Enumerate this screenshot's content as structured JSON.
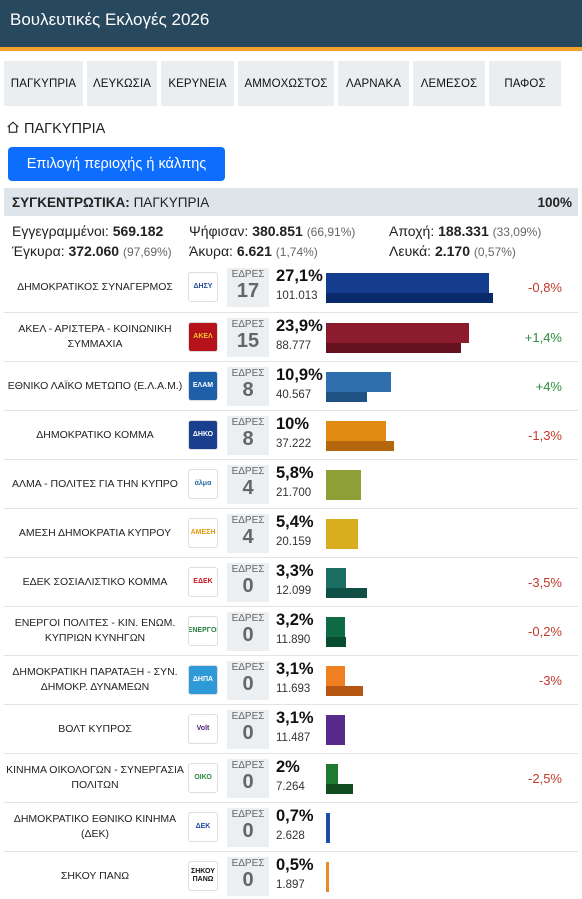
{
  "app": {
    "title": "Βουλευτικές Εκλογές 2026"
  },
  "tabs": [
    "ΠΑΓΚΥΠΡΙΑ",
    "ΛΕΥΚΩΣΙΑ",
    "ΚΕΡΥΝΕΙΑ",
    "ΑΜΜΟΧΩΣΤΟΣ",
    "ΛΑΡΝΑΚΑ",
    "ΛΕΜΕΣΟΣ",
    "ΠΑΦΟΣ"
  ],
  "breadcrumb": {
    "label": "ΠΑΓΚΥΠΡΙΑ",
    "icon": "home-icon"
  },
  "select_button": {
    "label": "Επιλογή περιοχής ή κάλπης"
  },
  "summary": {
    "prefix": "ΣΥΓΚΕΝΤΡΩΤΙΚΑ:",
    "region": "ΠΑΓΚΥΠΡΙΑ",
    "counted": "100%"
  },
  "stats": {
    "registered_label": "Εγγεγραμμένοι:",
    "registered": "569.182",
    "voted_label": "Ψήφισαν:",
    "voted": "380.851",
    "voted_pct": "(66,91%)",
    "abstention_label": "Αποχή:",
    "abstention": "188.331",
    "abstention_pct": "(33,09%)",
    "valid_label": "Έγκυρα:",
    "valid": "372.060",
    "valid_pct": "(97,69%)",
    "invalid_label": "Άκυρα:",
    "invalid": "6.621",
    "invalid_pct": "(1,74%)",
    "blank_label": "Λευκά:",
    "blank": "2.170",
    "blank_pct": "(0,57%)"
  },
  "seats_label": "ΕΔΡΕΣ",
  "parties": [
    {
      "name": "ΔΗΜΟΚΡΑΤΙΚΟΣ ΣΥΝΑΓΕΡΜΟΣ",
      "seats": "17",
      "pct": "27,1%",
      "votes": "101.013",
      "change": "-0,8%",
      "change_type": "neg",
      "share": 27.1,
      "prev_share": 27.9,
      "color": "#143d8f",
      "color_dark": "#0b2a6b",
      "logo_bg": "#ffffff",
      "logo_fg": "#1f4e9a",
      "logo_text": "ΔΗΣΥ",
      "logo_icon": "eagle-icon"
    },
    {
      "name": "ΑΚΕΛ - ΑΡΙΣΤΕΡΑ - ΚΟΙΝΩΝΙΚΗ ΣΥΜΜΑΧΙΑ",
      "seats": "15",
      "pct": "23,9%",
      "votes": "88.777",
      "change": "+1,4%",
      "change_type": "pos",
      "share": 23.9,
      "prev_share": 22.5,
      "color": "#8c1b2e",
      "color_dark": "#651120",
      "logo_bg": "#b5121b",
      "logo_fg": "#f4c430",
      "logo_text": "ΑΚΕΛ",
      "logo_icon": "akel-emblem-icon"
    },
    {
      "name": "ΕΘΝΙΚΟ ΛΑΪΚΟ ΜΕΤΩΠΟ (Ε.Λ.Α.Μ.)",
      "seats": "8",
      "pct": "10,9%",
      "votes": "40.567",
      "change": "+4%",
      "change_type": "pos",
      "share": 10.9,
      "prev_share": 6.9,
      "color": "#2f6fae",
      "color_dark": "#1e5184",
      "logo_bg": "#1d5fa8",
      "logo_fg": "#ffffff",
      "logo_text": "ΕΛΑΜ",
      "logo_icon": "elam-emblem-icon"
    },
    {
      "name": "ΔΗΜΟΚΡΑΤΙΚΟ ΚΟΜΜΑ",
      "seats": "8",
      "pct": "10%",
      "votes": "37.222",
      "change": "-1,3%",
      "change_type": "neg",
      "share": 10.0,
      "prev_share": 11.3,
      "color": "#e08a12",
      "color_dark": "#b4670c",
      "logo_bg": "#1b3f8f",
      "logo_fg": "#ffffff",
      "logo_text": "ΔΗΚΟ",
      "logo_icon": "diko-emblem-icon"
    },
    {
      "name": "ΑΛΜΑ - ΠΟΛΙΤΕΣ ΓΙΑ ΤΗΝ ΚΥΠΡΟ",
      "seats": "4",
      "pct": "5,8%",
      "votes": "21.700",
      "change": "",
      "change_type": "none",
      "share": 5.8,
      "prev_share": 0,
      "color": "#8e9f38",
      "color_dark": "#6d7c25",
      "logo_bg": "#ffffff",
      "logo_fg": "#2f6aa8",
      "logo_text": "άλμα",
      "logo_icon": "alma-logo-icon"
    },
    {
      "name": "ΑΜΕΣΗ ΔΗΜΟΚΡΑΤΙΑ ΚΥΠΡΟΥ",
      "seats": "4",
      "pct": "5,4%",
      "votes": "20.159",
      "change": "",
      "change_type": "none",
      "share": 5.4,
      "prev_share": 0,
      "color": "#d9ad1f",
      "color_dark": "#b08912",
      "logo_bg": "#ffffff",
      "logo_fg": "#e09b12",
      "logo_text": "ΑΜΕΣΗ",
      "logo_icon": "amesi-logo-icon"
    },
    {
      "name": "ΕΔΕΚ ΣΟΣΙΑΛΙΣΤΙΚΟ ΚΟΜΜΑ",
      "seats": "0",
      "pct": "3,3%",
      "votes": "12.099",
      "change": "-3,5%",
      "change_type": "neg",
      "share": 3.3,
      "prev_share": 6.8,
      "color": "#1c6e63",
      "color_dark": "#0f4f46",
      "logo_bg": "#ffffff",
      "logo_fg": "#c8161d",
      "logo_text": "ΕΔΕΚ",
      "logo_icon": "fist-icon"
    },
    {
      "name": "ΕΝΕΡΓΟΙ ΠΟΛΙΤΕΣ - ΚΙΝ. ΕΝΩΜ. ΚΥΠΡΙΩΝ ΚΥΝΗΓΩΝ",
      "seats": "0",
      "pct": "3,2%",
      "votes": "11.890",
      "change": "-0,2%",
      "change_type": "neg",
      "share": 3.2,
      "prev_share": 3.4,
      "color": "#0f6b46",
      "color_dark": "#084d31",
      "logo_bg": "#ffffff",
      "logo_fg": "#2a7d3b",
      "logo_text": "ΕΝΕΡΓΟΙ",
      "logo_icon": "energoi-logo-icon"
    },
    {
      "name": "ΔΗΜΟΚΡΑΤΙΚΗ ΠΑΡΑΤΑΞΗ - ΣΥΝ. ΔΗΜΟΚΡ. ΔΥΝΑΜΕΩΝ",
      "seats": "0",
      "pct": "3,1%",
      "votes": "11.693",
      "change": "-3%",
      "change_type": "neg",
      "share": 3.1,
      "prev_share": 6.1,
      "color": "#f07f22",
      "color_dark": "#b55612",
      "logo_bg": "#2f9ad8",
      "logo_fg": "#ffffff",
      "logo_text": "ΔΗΠΑ",
      "logo_icon": "dipa-logo-icon"
    },
    {
      "name": "ΒΟΛΤ ΚΥΠΡΟΣ",
      "seats": "0",
      "pct": "3,1%",
      "votes": "11.487",
      "change": "",
      "change_type": "none",
      "share": 3.1,
      "prev_share": 0,
      "color": "#582a8c",
      "color_dark": "#3f1b68",
      "logo_bg": "#ffffff",
      "logo_fg": "#502379",
      "logo_text": "Volt",
      "logo_icon": "volt-logo-icon"
    },
    {
      "name": "ΚΙΝΗΜΑ ΟΙΚΟΛΟΓΩΝ - ΣΥΝΕΡΓΑΣΙΑ ΠΟΛΙΤΩΝ",
      "seats": "0",
      "pct": "2%",
      "votes": "7.264",
      "change": "-2,5%",
      "change_type": "neg",
      "share": 2.0,
      "prev_share": 4.5,
      "color": "#1f7a32",
      "color_dark": "#114d1f",
      "logo_bg": "#ffffff",
      "logo_fg": "#2e8b3d",
      "logo_text": "ΟΙΚΟ",
      "logo_icon": "sun-icon"
    },
    {
      "name": "ΔΗΜΟΚΡΑΤΙΚΟ ΕΘΝΙΚΟ ΚΙΝΗΜΑ (ΔΕΚ)",
      "seats": "0",
      "pct": "0,7%",
      "votes": "2.628",
      "change": "",
      "change_type": "none",
      "share": 0.7,
      "prev_share": 0,
      "color": "#1d4ea0",
      "color_dark": "#133a7a",
      "logo_bg": "#ffffff",
      "logo_fg": "#1d4ea0",
      "logo_text": "ΔΕΚ",
      "logo_icon": "dek-logo-icon"
    },
    {
      "name": "ΣΗΚΟΥ ΠΑΝΩ",
      "seats": "0",
      "pct": "0,5%",
      "votes": "1.897",
      "change": "",
      "change_type": "none",
      "share": 0.5,
      "prev_share": 0,
      "color": "#e8892b",
      "color_dark": "#b86512",
      "logo_bg": "#ffffff",
      "logo_fg": "#111111",
      "logo_text": "ΣΗΚΟΥ ΠΑΝΩ",
      "logo_icon": "sikou-pano-logo-icon"
    }
  ]
}
